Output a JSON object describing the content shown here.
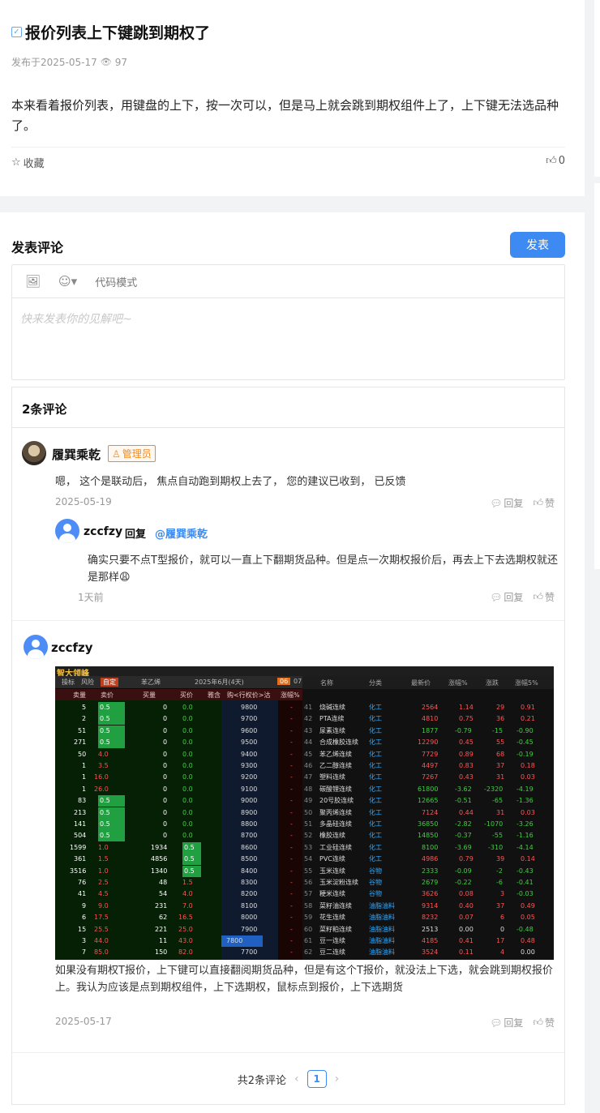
{
  "post": {
    "title": "报价列表上下键跳到期权了",
    "published": "发布于2025-05-17",
    "views": "97",
    "body": "本来看着报价列表，用键盘的上下，按一次可以，但是马上就会跳到期权组件上了，上下键无法选品种了。",
    "favorite_label": "收藏",
    "likes": "0"
  },
  "editor": {
    "section_title": "发表评论",
    "publish_label": "发表",
    "code_mode_label": "代码模式",
    "placeholder": "快来发表你的见解吧~"
  },
  "comments": {
    "count_title": "2条评论",
    "reply_label": "回复",
    "like_label": "赞",
    "items": [
      {
        "author": "履巽乘乾",
        "badge": "管理员",
        "text": "嗯， 这个是联动后， 焦点自动跑到期权上去了， 您的建议已收到， 已反馈",
        "date": "2025-05-19",
        "reply": {
          "author": "zccfzy",
          "reply_word": "回复",
          "target": "@履巽乘乾",
          "text": "确实只要不点T型报价，就可以一直上下翻期货品种。但是点一次期权报价后，再去上下去选期权就还是那样😩",
          "date": "1天前"
        }
      },
      {
        "author": "zccfzy",
        "caption": "如果没有期权T报价，上下键可以直接翻阅期货品种，但是有这个T报价，就没法上下选，就会跳到期权报价上。我认为应该是点到期权组件，上下选期权，鼠标点到报价，上下选期货",
        "date": "2025-05-17"
      }
    ]
  },
  "pagination": {
    "total": "共2条评论",
    "current": "1"
  },
  "screenshot": {
    "logo": "智大领峰",
    "tabs": [
      "操标",
      "风险",
      "自定",
      "苯乙烯",
      "2025年6月(4天)",
      "06",
      "07"
    ],
    "header": [
      "卖量",
      "卖价",
      "买量",
      "买价",
      "雅含",
      "购<行权价>沽",
      "涨幅%"
    ],
    "list_header": [
      "名称",
      "分类",
      "最新价",
      "涨幅%",
      "涨跌",
      "涨幅5%"
    ],
    "rows": [
      [
        "5",
        "0.5",
        "0",
        "0.0",
        "9800",
        "41",
        "烧碱连续",
        "化工",
        "2564",
        "1.14",
        "29",
        "0.91"
      ],
      [
        "2",
        "0.5",
        "0",
        "0.0",
        "9700",
        "42",
        "PTA连续",
        "化工",
        "4810",
        "0.75",
        "36",
        "0.21"
      ],
      [
        "51",
        "0.5",
        "0",
        "0.0",
        "9600",
        "43",
        "尿素连续",
        "化工",
        "1877",
        "-0.79",
        "-15",
        "-0.90"
      ],
      [
        "271",
        "0.5",
        "0",
        "0.0",
        "9500",
        "44",
        "合成橡胶连续",
        "化工",
        "12290",
        "0.45",
        "55",
        "-0.45"
      ],
      [
        "50",
        "4.0",
        "0",
        "0.0",
        "9400",
        "45",
        "苯乙烯连续",
        "化工",
        "7729",
        "0.89",
        "68",
        "-0.19"
      ],
      [
        "1",
        "3.5",
        "0",
        "0.0",
        "9300",
        "46",
        "乙二醇连续",
        "化工",
        "4497",
        "0.83",
        "37",
        "0.18"
      ],
      [
        "1",
        "16.0",
        "0",
        "0.0",
        "9200",
        "47",
        "塑料连续",
        "化工",
        "7267",
        "0.43",
        "31",
        "0.03"
      ],
      [
        "1",
        "26.0",
        "0",
        "0.0",
        "9100",
        "48",
        "碳酸锂连续",
        "化工",
        "61800",
        "-3.62",
        "-2320",
        "-4.19"
      ],
      [
        "83",
        "0.5",
        "0",
        "0.0",
        "9000",
        "49",
        "20号胶连续",
        "化工",
        "12665",
        "-0.51",
        "-65",
        "-1.36"
      ],
      [
        "213",
        "0.5",
        "0",
        "0.0",
        "8900",
        "50",
        "聚丙烯连续",
        "化工",
        "7124",
        "0.44",
        "31",
        "0.03"
      ],
      [
        "141",
        "0.5",
        "0",
        "0.0",
        "8800",
        "51",
        "多晶硅连续",
        "化工",
        "36850",
        "-2.82",
        "-1070",
        "-3.26"
      ],
      [
        "504",
        "0.5",
        "0",
        "0.0",
        "8700",
        "52",
        "橡胶连续",
        "化工",
        "14850",
        "-0.37",
        "-55",
        "-1.16"
      ],
      [
        "1599",
        "1.0",
        "1934",
        "0.5",
        "8600",
        "53",
        "工业硅连续",
        "化工",
        "8100",
        "-3.69",
        "-310",
        "-4.14"
      ],
      [
        "361",
        "1.5",
        "4856",
        "0.5",
        "8500",
        "54",
        "PVC连续",
        "化工",
        "4986",
        "0.79",
        "39",
        "0.14"
      ],
      [
        "3516",
        "1.0",
        "1340",
        "0.5",
        "8400",
        "55",
        "玉米连续",
        "谷物",
        "2333",
        "-0.09",
        "-2",
        "-0.43"
      ],
      [
        "76",
        "2.5",
        "48",
        "1.5",
        "8300",
        "56",
        "玉米淀粉连续",
        "谷物",
        "2679",
        "-0.22",
        "-6",
        "-0.41"
      ],
      [
        "41",
        "4.5",
        "54",
        "4.0",
        "8200",
        "57",
        "粳米连续",
        "谷物",
        "3626",
        "0.08",
        "3",
        "-0.03"
      ],
      [
        "9",
        "9.0",
        "231",
        "7.0",
        "8100",
        "58",
        "菜籽油连续",
        "油脂油料",
        "9314",
        "0.40",
        "37",
        "0.49"
      ],
      [
        "6",
        "17.5",
        "62",
        "16.5",
        "8000",
        "59",
        "花生连续",
        "油脂油料",
        "8232",
        "0.07",
        "6",
        "0.05"
      ],
      [
        "15",
        "25.5",
        "221",
        "25.0",
        "7900",
        "60",
        "菜籽粕连续",
        "油脂油料",
        "2513",
        "0.00",
        "0",
        "-0.48"
      ],
      [
        "3",
        "44.0",
        "11",
        "43.0",
        "7800",
        "61",
        "豆一连续",
        "油脂油料",
        "4185",
        "0.41",
        "17",
        "0.48"
      ],
      [
        "7",
        "85.0",
        "150",
        "82.0",
        "7700",
        "62",
        "豆二连续",
        "油脂油料",
        "3524",
        "0.11",
        "4",
        "0.00"
      ]
    ]
  }
}
